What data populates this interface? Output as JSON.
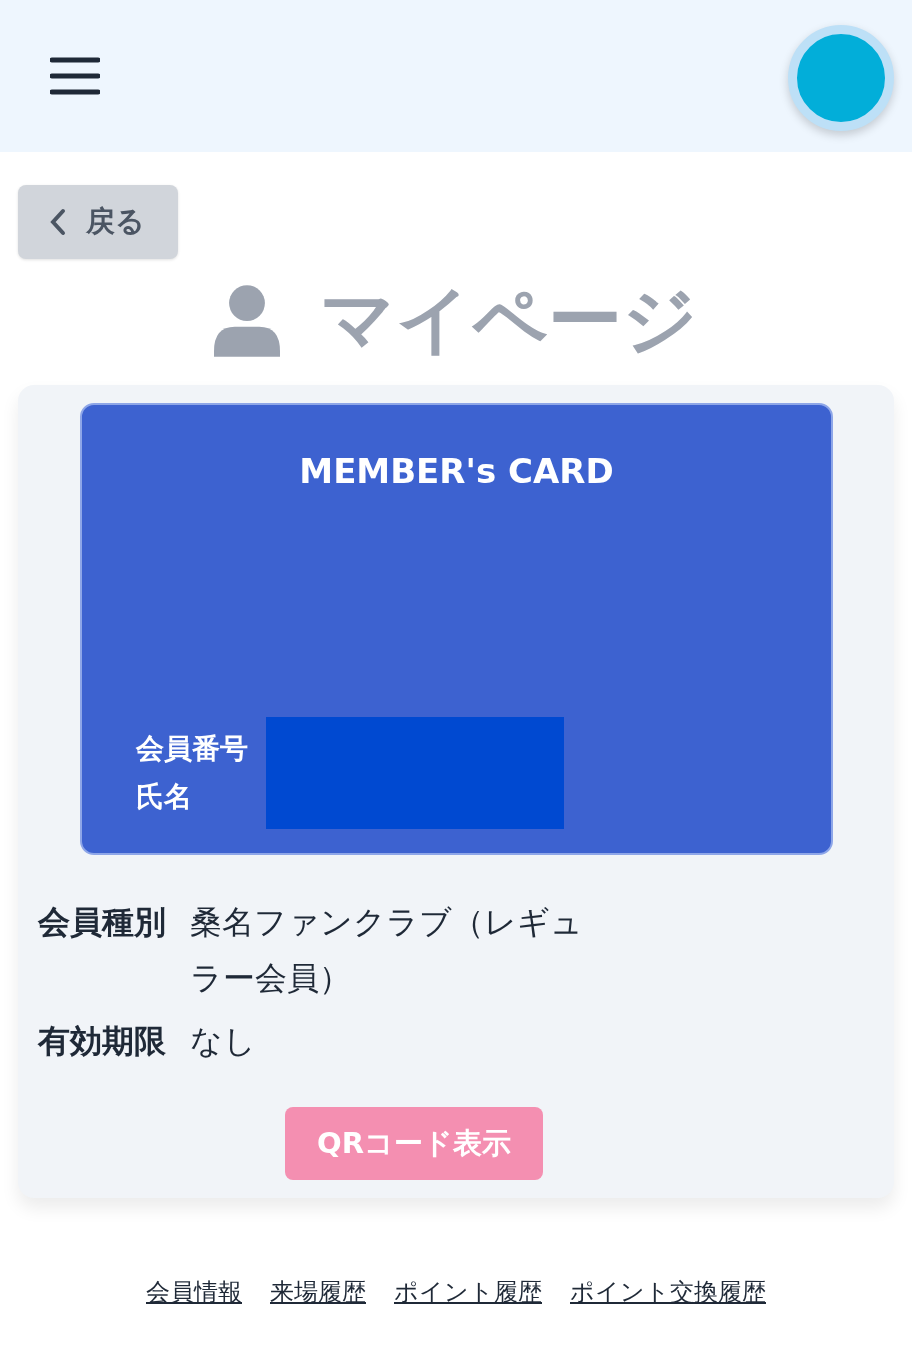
{
  "header": {
    "avatar": true
  },
  "back_button": {
    "label": "戻る"
  },
  "page_title": "マイページ",
  "member_card": {
    "title": "MEMBER's CARD",
    "labels": [
      "会員番号",
      "氏名"
    ]
  },
  "details": [
    {
      "label": "会員種別",
      "value": "桑名ファンクラブ（レギュラー会員）"
    },
    {
      "label": "有効期限",
      "value": "なし"
    }
  ],
  "qr_button": {
    "label": "QRコード表示"
  },
  "footer_links": [
    "会員情報",
    "来場履歴",
    "ポイント履歴",
    "ポイント交換履歴"
  ]
}
